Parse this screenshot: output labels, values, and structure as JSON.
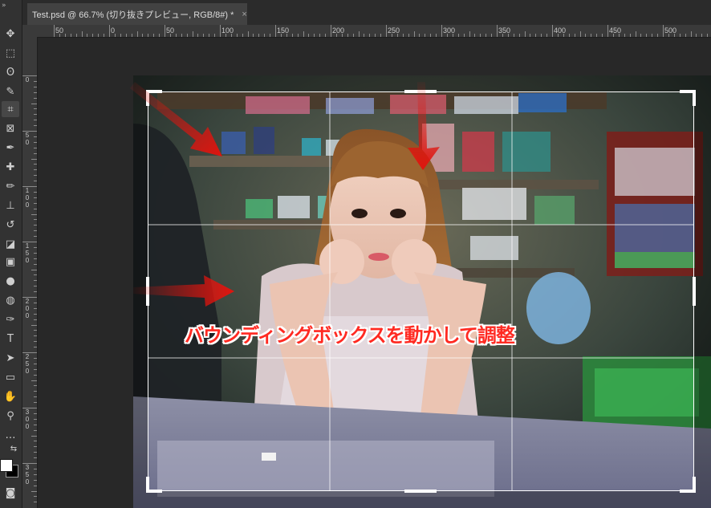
{
  "document_tab": {
    "title": "Test.psd @ 66.7% (切り抜きプレビュー, RGB/8#) *",
    "close_glyph": "×"
  },
  "toolbar": {
    "collapse_glyph": "»",
    "tools": [
      {
        "name": "move-tool-icon",
        "glyph": "✥"
      },
      {
        "name": "marquee-tool-icon",
        "glyph": "⬚"
      },
      {
        "name": "lasso-tool-icon",
        "glyph": "ʘ"
      },
      {
        "name": "quick-select-tool-icon",
        "glyph": "✎"
      },
      {
        "name": "crop-tool-icon",
        "glyph": "⌗"
      },
      {
        "name": "frame-tool-icon",
        "glyph": "⊠"
      },
      {
        "name": "eyedropper-tool-icon",
        "glyph": "✒"
      },
      {
        "name": "healing-brush-tool-icon",
        "glyph": "✚"
      },
      {
        "name": "brush-tool-icon",
        "glyph": "✏"
      },
      {
        "name": "clone-stamp-tool-icon",
        "glyph": "⊥"
      },
      {
        "name": "history-brush-tool-icon",
        "glyph": "↺"
      },
      {
        "name": "eraser-tool-icon",
        "glyph": "◪"
      },
      {
        "name": "gradient-tool-icon",
        "glyph": "▣"
      },
      {
        "name": "blur-tool-icon",
        "glyph": "●"
      },
      {
        "name": "dodge-tool-icon",
        "glyph": "◍"
      },
      {
        "name": "pen-tool-icon",
        "glyph": "✑"
      },
      {
        "name": "type-tool-icon",
        "glyph": "T"
      },
      {
        "name": "path-select-tool-icon",
        "glyph": "➤"
      },
      {
        "name": "shape-tool-icon",
        "glyph": "▭"
      },
      {
        "name": "hand-tool-icon",
        "glyph": "✋"
      },
      {
        "name": "zoom-tool-icon",
        "glyph": "⚲"
      },
      {
        "name": "more-tools-icon",
        "glyph": "…"
      }
    ],
    "swap_colors_glyph": "⇆",
    "quick_mask_glyph": "◙",
    "foreground_color": "#ffffff",
    "background_color": "#000000"
  },
  "ruler_top": {
    "labels": [
      "50",
      "0",
      "50",
      "100",
      "150",
      "200",
      "250",
      "300",
      "350",
      "400",
      "450",
      "500",
      "550"
    ]
  },
  "ruler_left": {
    "labels": [
      [
        "0"
      ],
      [
        "5",
        "0"
      ],
      [
        "1",
        "0",
        "0"
      ],
      [
        "1",
        "5",
        "0"
      ],
      [
        "2",
        "0",
        "0"
      ],
      [
        "2",
        "5",
        "0"
      ],
      [
        "3",
        "0",
        "0"
      ],
      [
        "3",
        "5",
        "0"
      ]
    ]
  },
  "canvas": {
    "caption": "バウンディングボックスを動かして調整",
    "caption_color": "#ff2a22",
    "arrow_color": "#e0140e",
    "crop_grid_color": "#ffffff"
  }
}
